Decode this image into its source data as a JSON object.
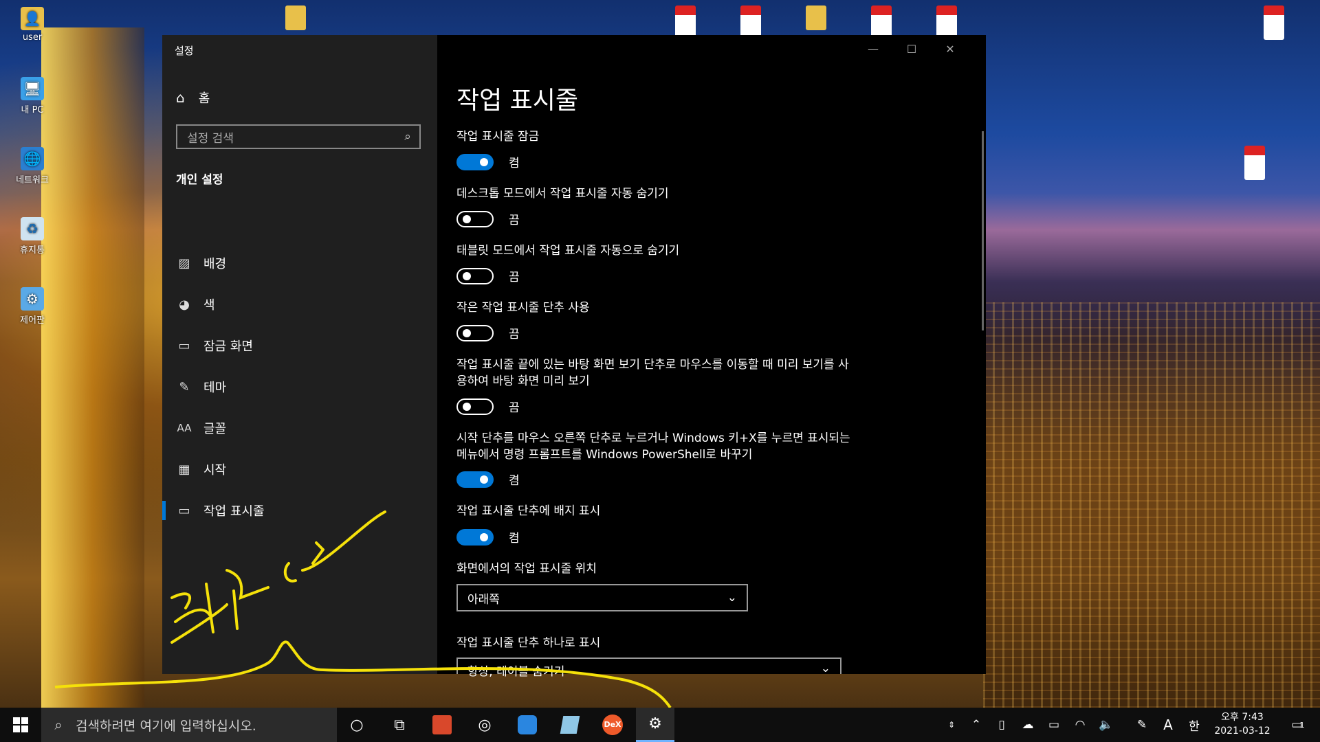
{
  "desktop": {
    "icons": [
      {
        "label": "user",
        "icon": "user-folder-icon"
      },
      {
        "label": "내 PC",
        "icon": "pc-icon"
      },
      {
        "label": "네트워크",
        "icon": "network-icon"
      },
      {
        "label": "휴지통",
        "icon": "recycle-bin-icon"
      },
      {
        "label": "제어판",
        "icon": "control-panel-icon"
      }
    ]
  },
  "window": {
    "title": "설정",
    "controls": {
      "minimize": "—",
      "maximize": "☐",
      "close": "✕"
    }
  },
  "nav": {
    "home_label": "홈",
    "search_placeholder": "설정 검색",
    "section_title": "개인 설정",
    "items": [
      {
        "label": "배경",
        "icon": "image-icon",
        "active": false
      },
      {
        "label": "색",
        "icon": "palette-icon",
        "active": false
      },
      {
        "label": "잠금 화면",
        "icon": "lock-screen-icon",
        "active": false
      },
      {
        "label": "테마",
        "icon": "theme-icon",
        "active": false
      },
      {
        "label": "글꼴",
        "icon": "font-icon",
        "active": false
      },
      {
        "label": "시작",
        "icon": "start-icon",
        "active": false
      },
      {
        "label": "작업 표시줄",
        "icon": "taskbar-icon",
        "active": true
      }
    ]
  },
  "content": {
    "page_title": "작업 표시줄",
    "settings": [
      {
        "label": "작업 표시줄 잠금",
        "state": "켬",
        "on": true
      },
      {
        "label": "데스크톱 모드에서 작업 표시줄 자동 숨기기",
        "state": "끔",
        "on": false
      },
      {
        "label": "태블릿 모드에서 작업 표시줄 자동으로 숨기기",
        "state": "끔",
        "on": false
      },
      {
        "label": "작은 작업 표시줄 단추 사용",
        "state": "끔",
        "on": false
      },
      {
        "label": "작업 표시줄 끝에 있는 바탕 화면 보기 단추로 마우스를 이동할 때 미리 보기를 사용하여 바탕 화면 미리 보기",
        "state": "끔",
        "on": false
      },
      {
        "label": "시작 단추를 마우스 오른쪽 단추로 누르거나 Windows 키+X를 누르면 표시되는 메뉴에서 명령 프롬프트를 Windows PowerShell로 바꾸기",
        "state": "켬",
        "on": true
      },
      {
        "label": "작업 표시줄 단추에 배지 표시",
        "state": "켬",
        "on": true
      }
    ],
    "position": {
      "label": "화면에서의 작업 표시줄 위치",
      "value": "아래쪽"
    },
    "combine": {
      "label": "작업 표시줄 단추 하나로 표시",
      "value": "항상, 레이블 숨기기"
    }
  },
  "annotation": {
    "handwritten_text": "크기가 커요",
    "color": "#f5e10a"
  },
  "taskbar": {
    "search_placeholder": "검색하려면 여기에 입력하십시오.",
    "apps": [
      "cortana-icon",
      "task-view-icon",
      "app-red-icon",
      "browser-icon",
      "app-blue-icon",
      "app-files-icon",
      "dex-icon",
      "settings-gear-icon"
    ],
    "dex_label": "DeX",
    "tray": {
      "ime_lang": "A",
      "ime_mode": "한",
      "notification_count": "1"
    },
    "clock": {
      "time": "오후 7:43",
      "date": "2021-03-12"
    }
  },
  "colors": {
    "accent": "#0078d7",
    "nav_bg": "#1f1f1f",
    "content_bg": "#000000"
  }
}
